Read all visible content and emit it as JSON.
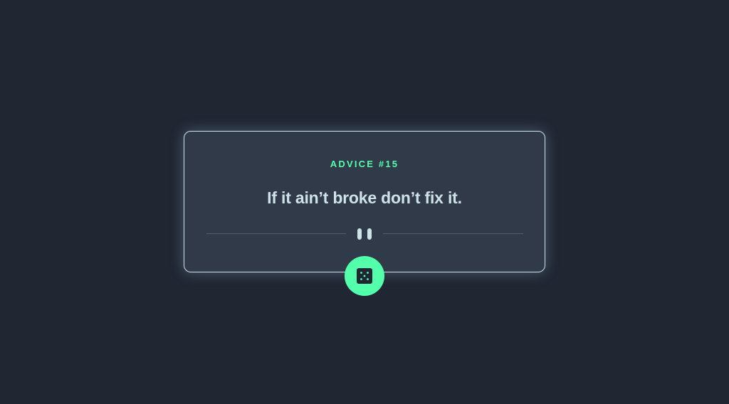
{
  "advice": {
    "id_label": "ADVICE #15",
    "text": "If it ain’t broke don’t fix it."
  },
  "divider": {
    "icon": "pause-icon"
  },
  "dice_button": {
    "icon": "dice-icon"
  },
  "colors": {
    "background": "#202632",
    "card": "#313a48",
    "accent": "#53ffab",
    "text": "#cee3e9",
    "divider": "#4f5d74"
  }
}
